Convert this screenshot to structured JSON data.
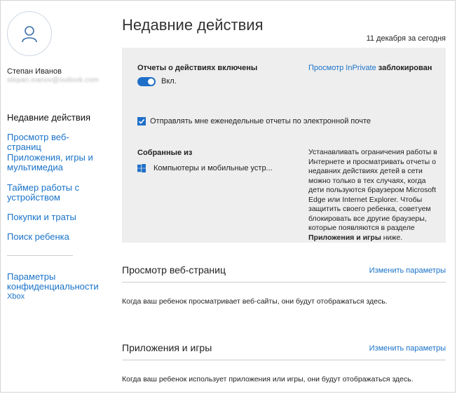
{
  "user": {
    "name": "Степан Иванов",
    "email": "stepan.ivanov@outlook.com"
  },
  "sidebar": {
    "items": [
      {
        "label": "Недавние действия",
        "active": true
      },
      {
        "label": "Просмотр веб-страниц",
        "active": false
      },
      {
        "label": "Приложения, игры и мультимедиа",
        "active": false
      },
      {
        "label": "Таймер работы с устройством",
        "active": false
      },
      {
        "label": "Покупки и траты",
        "active": false
      },
      {
        "label": "Поиск ребенка",
        "active": false
      }
    ],
    "privacy": {
      "label": "Параметры конфиденциальности",
      "sub": "Xbox"
    }
  },
  "main": {
    "title": "Недавние действия",
    "date_range": "11 декабря за сегодня",
    "panel": {
      "reports_label": "Отчеты о действиях включены",
      "toggle_state": "Вкл.",
      "inprivate_link": "Просмотр InPrivate",
      "inprivate_status": "заблокирован",
      "weekly_email_label": "Отправлять мне еженедельные отчеты по электронной почте",
      "collected_label": "Собранные из",
      "device_text": "Компьютеры и мобильные устр...",
      "note_text": "Устанавливать ограничения работы в Интернете и просматривать отчеты о недавних действиях детей в сети можно только в тех случаях, когда дети пользуются браузером Microsoft Edge или Internet Explorer. Чтобы защитить своего ребенка, советуем блокировать все другие браузеры, которые появляются в разделе",
      "note_bold": "Приложения и игры",
      "note_tail": "ниже."
    },
    "sections": [
      {
        "title": "Просмотр веб-страниц",
        "link": "Изменить параметры",
        "text": "Когда ваш ребенок просматривает веб-сайты, они будут отображаться здесь."
      },
      {
        "title": "Приложения и игры",
        "link": "Изменить параметры",
        "text": "Когда ваш ребенок использует приложения или игры, они будут отображаться здесь."
      }
    ]
  },
  "colors": {
    "accent": "#1f6fc9",
    "link": "#1a73c9",
    "panel_bg": "#eeeeee"
  }
}
